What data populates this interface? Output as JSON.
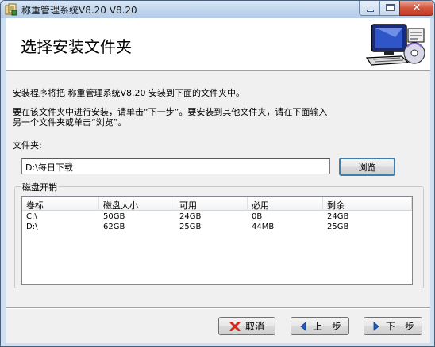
{
  "window": {
    "title": "称重管理系统V8.20 V8.20"
  },
  "header": {
    "title": "选择安装文件夹",
    "art_icon": "computer-install-icon"
  },
  "description": {
    "line1": "安装程序将把 称重管理系统V8.20 安装到下面的文件夹中。",
    "line2": "要在该文件夹中进行安装，请单击“下一步”。要安装到其他文件夹，请在下面输入",
    "line3": "另一个文件夹或单击“浏览”。"
  },
  "folder": {
    "label": "文件夹:",
    "value": "D:\\每日下载",
    "browse_label": "浏览"
  },
  "disk": {
    "group_label": "磁盘开销",
    "columns": [
      "卷标",
      "磁盘大小",
      "可用",
      "必用",
      "剩余"
    ],
    "rows": [
      [
        "C:\\",
        "50GB",
        "24GB",
        "0B",
        "24GB"
      ],
      [
        "D:\\",
        "62GB",
        "25GB",
        "44MB",
        "25GB"
      ]
    ]
  },
  "footer": {
    "cancel_label": "取消",
    "back_label": "上一步",
    "next_label": "下一步"
  },
  "colors": {
    "cancel_icon": "#d4281c",
    "nav_icon": "#1f5fbf"
  }
}
